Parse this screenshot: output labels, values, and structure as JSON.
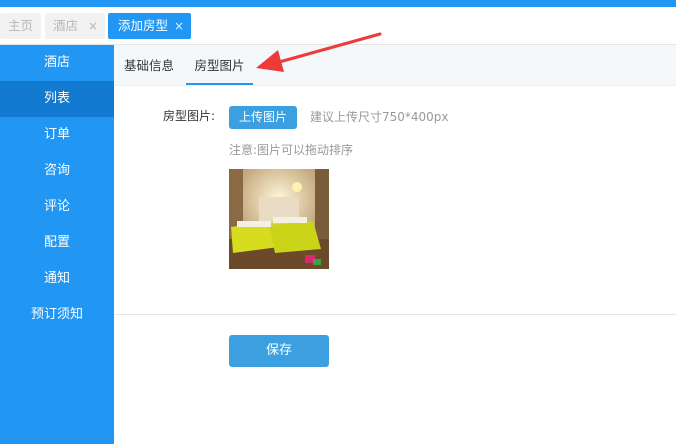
{
  "tabs": [
    {
      "label": "主页",
      "closable": false
    },
    {
      "label": "酒店",
      "close_glyph": "×"
    },
    {
      "label": "添加房型",
      "close_glyph": "×",
      "active": true
    }
  ],
  "sidebar": {
    "items": [
      {
        "label": "酒店"
      },
      {
        "label": "列表",
        "active": true
      },
      {
        "label": "订单"
      },
      {
        "label": "咨询"
      },
      {
        "label": "评论"
      },
      {
        "label": "配置"
      },
      {
        "label": "通知"
      },
      {
        "label": "预订须知"
      }
    ]
  },
  "subtabs": [
    {
      "label": "基础信息"
    },
    {
      "label": "房型图片",
      "active": true
    }
  ],
  "form": {
    "label": "房型图片:",
    "upload_label": "上传图片",
    "upload_hint": "建议上传尺寸750*400px",
    "note": "注意:图片可以拖动排序",
    "save_label": "保存"
  },
  "colors": {
    "brand": "#2196f3",
    "sidebar_active": "#137ad1",
    "button": "#3b9fe0",
    "annotation": "#ef3a3a"
  }
}
